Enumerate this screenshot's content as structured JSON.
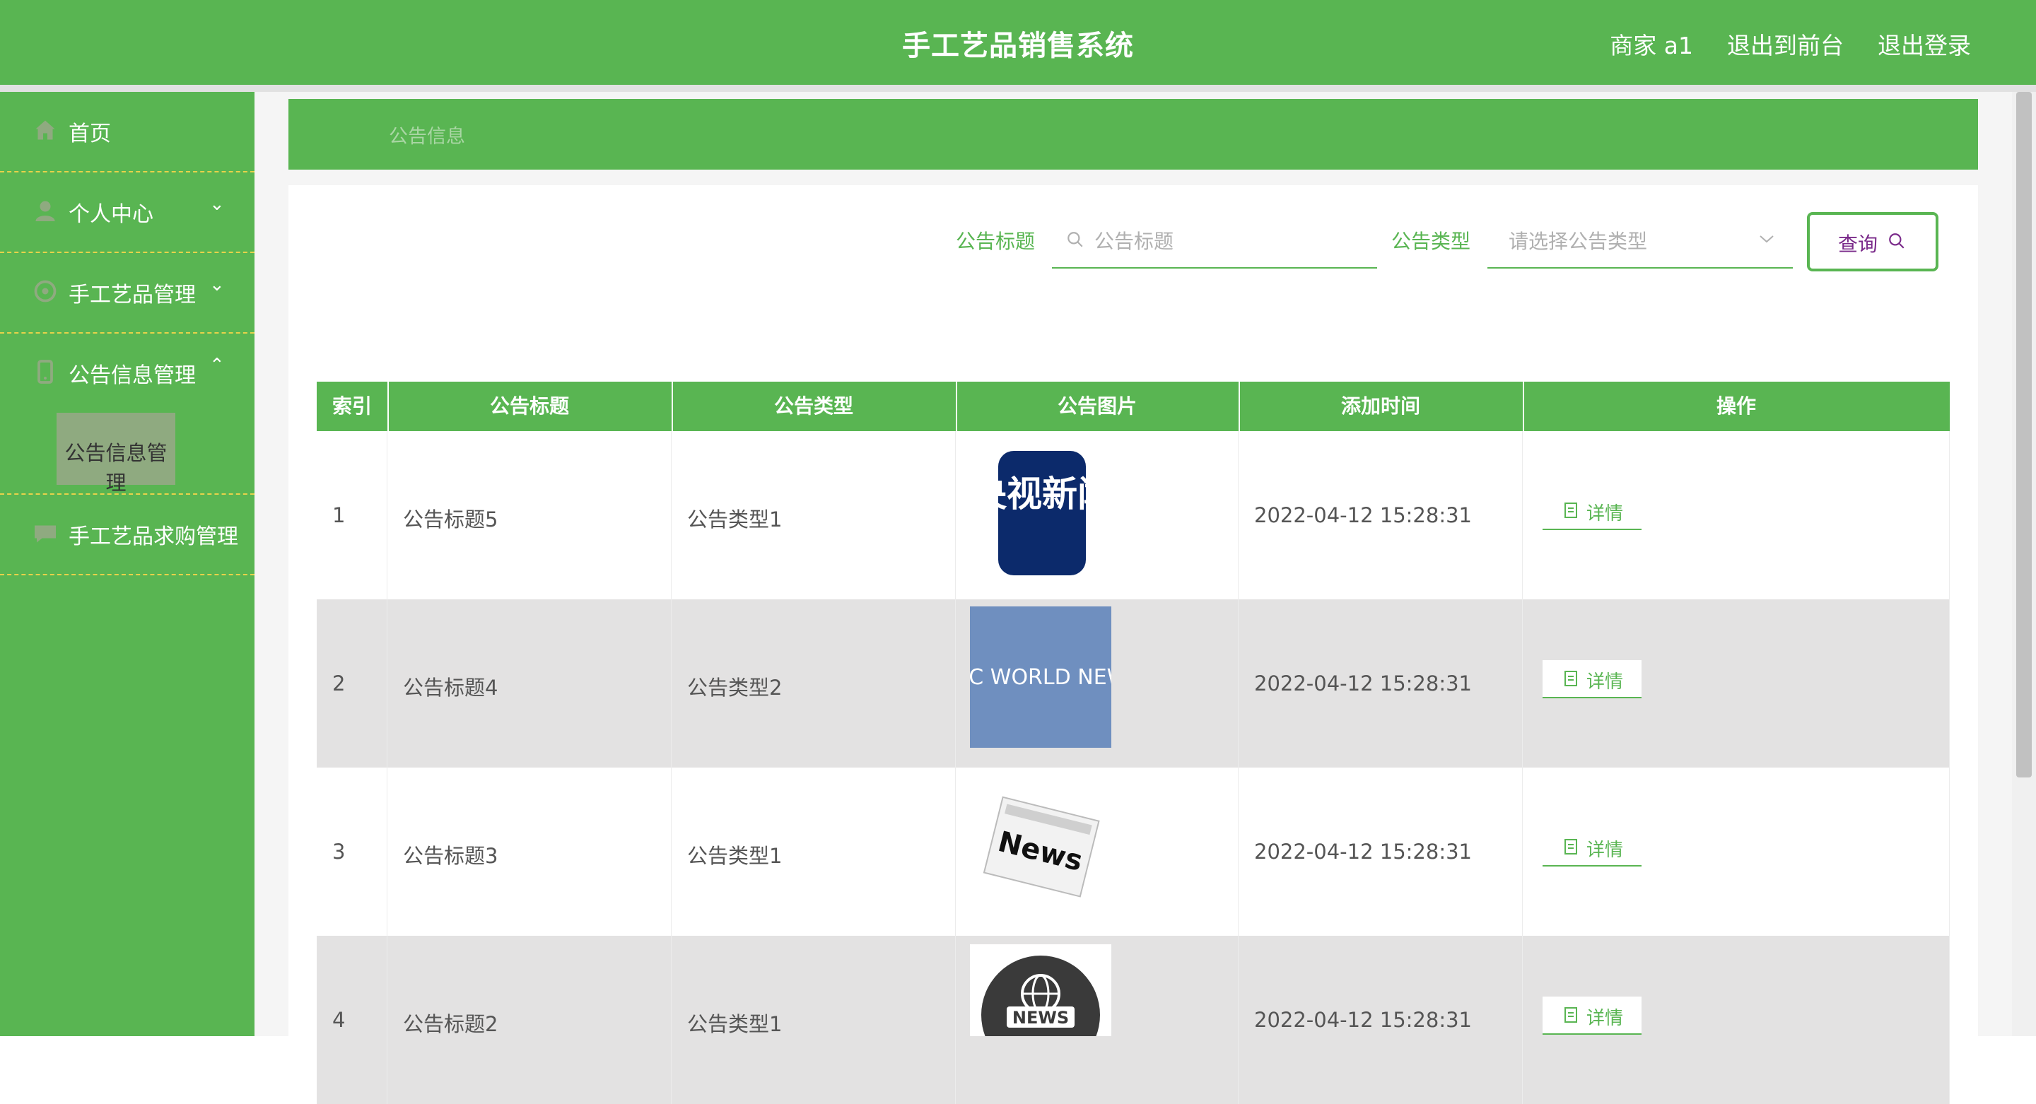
{
  "header": {
    "title": "手工艺品销售系统",
    "user": "商家 a1",
    "to_front": "退出到前台",
    "logout": "退出登录"
  },
  "sidebar": {
    "items": [
      {
        "label": "首页",
        "icon": "home-icon"
      },
      {
        "label": "个人中心",
        "icon": "user-icon",
        "chevron": "⌄"
      },
      {
        "label": "手工艺品管理",
        "icon": "craft-icon",
        "chevron": "⌄"
      },
      {
        "label": "公告信息管理",
        "icon": "phone-icon",
        "chevron": "⌃"
      },
      {
        "label": "手工艺品求购管理",
        "icon": "chat-icon"
      }
    ],
    "subitem": "公告信息管理"
  },
  "breadcrumb": "公告信息",
  "search": {
    "title_label": "公告标题",
    "title_placeholder": "公告标题",
    "type_label": "公告类型",
    "type_placeholder": "请选择公告类型",
    "query_label": "查询"
  },
  "table": {
    "headers": [
      "索引",
      "公告标题",
      "公告类型",
      "公告图片",
      "添加时间",
      "操作"
    ],
    "rows": [
      {
        "index": "1",
        "title": "公告标题5",
        "type": "公告类型1",
        "image": "央视新闻",
        "time": "2022-04-12 15:28:31",
        "action": "详情"
      },
      {
        "index": "2",
        "title": "公告标题4",
        "type": "公告类型2",
        "image": "BBC WORLD NEWS",
        "time": "2022-04-12 15:28:31",
        "action": "详情"
      },
      {
        "index": "3",
        "title": "公告标题3",
        "type": "公告类型1",
        "image": "News",
        "time": "2022-04-12 15:28:31",
        "action": "详情"
      },
      {
        "index": "4",
        "title": "公告标题2",
        "type": "公告类型1",
        "image": "NEWS",
        "time": "2022-04-12 15:28:31",
        "action": "详情"
      }
    ]
  },
  "colors": {
    "primary": "#59b552",
    "divider": "#e7d24a",
    "submenu_active": "#8faa80"
  }
}
